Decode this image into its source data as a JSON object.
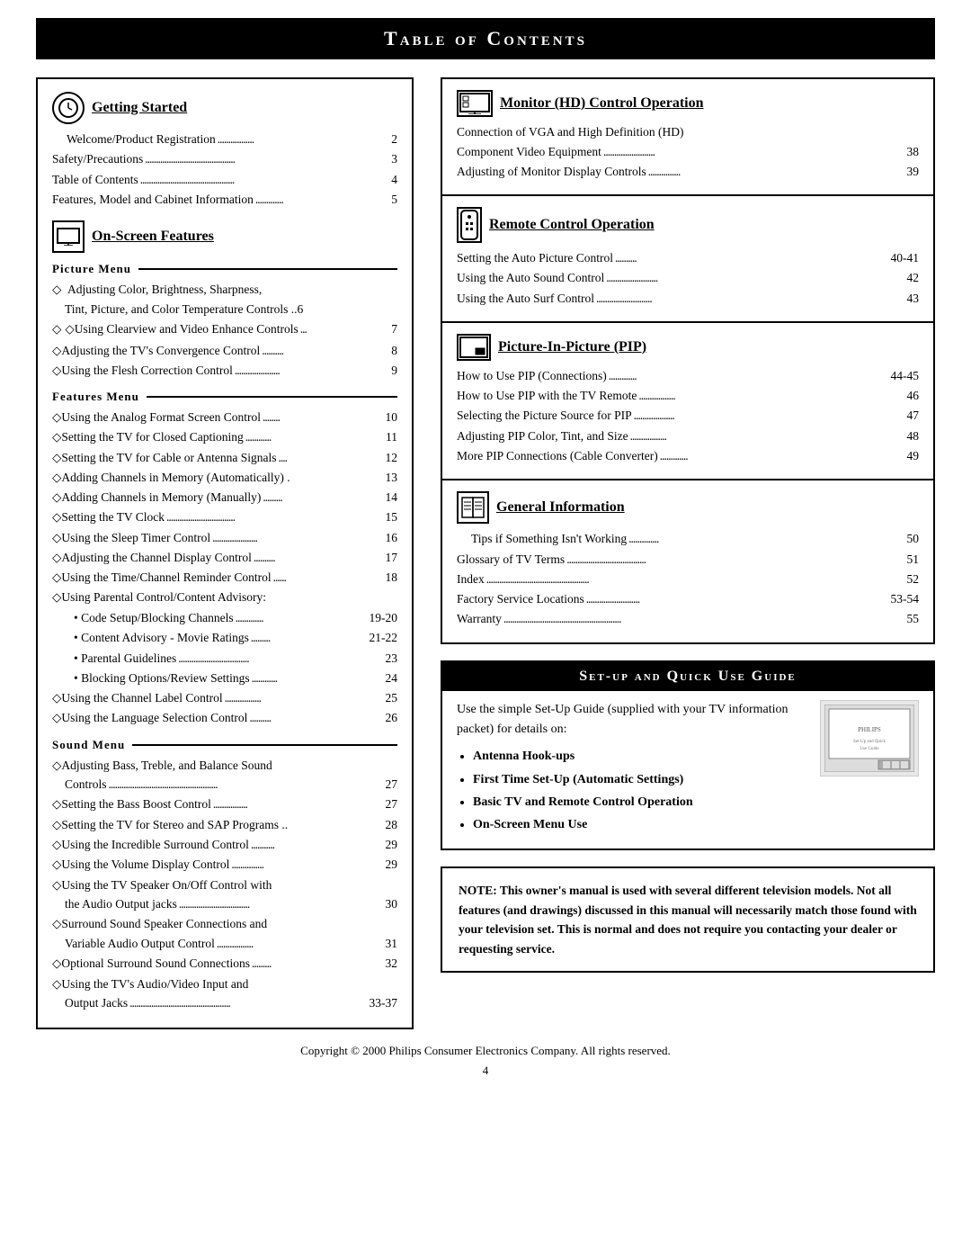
{
  "title": "Table of Contents",
  "left_col": {
    "getting_started": {
      "heading": "Getting Started",
      "entries": [
        {
          "label": "Welcome/Product Registration",
          "dots": true,
          "page": "2"
        },
        {
          "label": "Safety/Precautions",
          "dots": true,
          "page": "3"
        },
        {
          "label": "Table of Contents",
          "dots": true,
          "page": "4"
        },
        {
          "label": "Features, Model and Cabinet Information",
          "dots": true,
          "page": "5"
        }
      ]
    },
    "on_screen": {
      "heading": "On-Screen Features",
      "picture_menu": {
        "label": "Picture Menu",
        "items": [
          {
            "text": "Adjusting Color, Brightness, Sharpness, Tint, Picture, and Color Temperature Controls",
            "page": "6",
            "multiline": true
          },
          {
            "text": "Using Clearview and Video Enhance Controls",
            "page": "7",
            "dots": "..."
          },
          {
            "text": "Adjusting the TV's Convergence Control",
            "page": "8",
            "dots": ".........."
          },
          {
            "text": "Using the Flesh Correction Control",
            "page": "9",
            "dots": "..............."
          }
        ]
      },
      "features_menu": {
        "label": "Features Menu",
        "items": [
          {
            "text": "Using the Analog Format Screen Control",
            "page": "10",
            "dots": "........"
          },
          {
            "text": "Setting the TV for Closed Captioning",
            "page": "11",
            "dots": "..........."
          },
          {
            "text": "Setting the TV for Cable or Antenna Signals",
            "page": "12",
            "dots": "...."
          },
          {
            "text": "Adding Channels in Memory (Automatically)",
            "page": "13"
          },
          {
            "text": "Adding Channels in Memory (Manually)",
            "page": "14",
            "dots": "........"
          },
          {
            "text": "Setting the TV Clock",
            "page": "15",
            "dots": "................................"
          },
          {
            "text": "Using the Sleep Timer Control",
            "page": "16",
            "dots": "..................."
          },
          {
            "text": "Adjusting the Channel Display Control",
            "page": "17",
            "dots": ".........."
          },
          {
            "text": "Using the Time/Channel Reminder Control",
            "page": "18",
            "dots": "......"
          },
          {
            "text": "Using Parental Control/Content Advisory:",
            "page": "",
            "sub": [
              {
                "text": "Code Setup/Blocking Channels",
                "page": "19-20",
                "dots": "..........."
              },
              {
                "text": "Content Advisory - Movie Ratings",
                "page": "21-22",
                "dots": "........."
              },
              {
                "text": "Parental Guidelines",
                "page": "23",
                "dots": "...................................."
              },
              {
                "text": "Blocking Options/Review Settings",
                "page": "24",
                "dots": "............"
              }
            ]
          },
          {
            "text": "Using the Channel Label Control",
            "page": "25",
            "dots": "..............."
          },
          {
            "text": "Using the Language Selection Control",
            "page": "26",
            "dots": ".........."
          }
        ]
      },
      "sound_menu": {
        "label": "Sound Menu",
        "items": [
          {
            "text": "Adjusting Bass, Treble, and Balance Sound Controls",
            "page": "27",
            "dots": "...",
            "multiline": true
          },
          {
            "text": "Setting the Bass Boost Control",
            "page": "27",
            "dots": "........................"
          },
          {
            "text": "Setting the TV for Stereo and SAP Programs",
            "page": "28",
            "dots": ".."
          },
          {
            "text": "Using the Incredible Surround Control",
            "page": "29",
            "dots": "..........."
          },
          {
            "text": "Using the Volume Display Control",
            "page": "29",
            "dots": "..............."
          },
          {
            "text": "Using the TV Speaker On/Off Control with the Audio Output jacks",
            "page": "30",
            "dots": "...",
            "multiline": true
          },
          {
            "text": "Surround Sound Speaker Connections and Variable Audio Output Control",
            "page": "31",
            "dots": "................",
            "multiline": true
          },
          {
            "text": "Optional Surround Sound Connections",
            "page": "32",
            "dots": "........."
          },
          {
            "text": "Using the TV's Audio/Video Input and Output Jacks",
            "page": "33-37",
            "dots": "....................................",
            "multiline": true
          }
        ]
      }
    }
  },
  "right_col": {
    "monitor_hd": {
      "heading": "Monitor (HD) Control Operation",
      "entries": [
        {
          "label": "Connection of VGA and High Definition (HD) Component Video Equipment",
          "dots": true,
          "page": "38",
          "multiline": true
        },
        {
          "label": "Adjusting of Monitor Display Controls",
          "dots": true,
          "page": "39"
        }
      ]
    },
    "remote_control": {
      "heading": "Remote Control Operation",
      "entries": [
        {
          "label": "Setting the Auto Picture Control",
          "dots": true,
          "page": "40-41"
        },
        {
          "label": "Using the Auto Sound Control",
          "dots": true,
          "page": "42"
        },
        {
          "label": "Using the Auto Surf Control",
          "dots": true,
          "page": "43"
        }
      ]
    },
    "pip": {
      "heading": "Picture-In-Picture (PIP)",
      "entries": [
        {
          "label": "How to Use PIP (Connections)",
          "dots": true,
          "page": "44-45"
        },
        {
          "label": "How to Use PIP with the TV Remote",
          "dots": true,
          "page": "46"
        },
        {
          "label": "Selecting the Picture Source for PIP",
          "dots": true,
          "page": "47"
        },
        {
          "label": "Adjusting PIP Color, Tint, and Size",
          "dots": true,
          "page": "48"
        },
        {
          "label": "More PIP Connections (Cable Converter)",
          "dots": true,
          "page": "49"
        }
      ]
    },
    "general_info": {
      "heading": "General Information",
      "entries": [
        {
          "label": "Tips if Something Isn't Working",
          "dots": true,
          "page": "50"
        },
        {
          "label": "Glossary of TV Terms",
          "dots": true,
          "page": "51"
        },
        {
          "label": "Index",
          "dots": true,
          "page": "52"
        },
        {
          "label": "Factory Service Locations",
          "dots": true,
          "page": "53-54"
        },
        {
          "label": "Warranty",
          "dots": true,
          "page": "55"
        }
      ]
    }
  },
  "setup_guide": {
    "title": "Set-up and Quick Use Guide",
    "intro": "Use the simple Set-Up Guide (supplied with your TV information packet) for details on:",
    "bullets": [
      "Antenna Hook-ups",
      "First Time Set-Up (Automatic Settings)",
      "Basic TV and Remote Control Operation",
      "On-Screen Menu Use"
    ]
  },
  "note": {
    "text": "NOTE: This owner's manual is used with several different television models. Not all features (and drawings) discussed in this manual will necessarily match those found with your television set. This is normal and does not require you contacting your dealer or requesting service."
  },
  "copyright": "Copyright © 2000 Philips Consumer Electronics Company. All rights reserved.",
  "page_number": "4"
}
